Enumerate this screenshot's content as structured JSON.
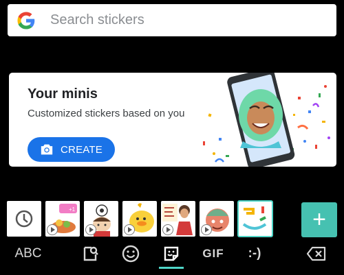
{
  "search": {
    "placeholder": "Search stickers",
    "logo_icon": "google-g-icon"
  },
  "promo": {
    "title": "Your minis",
    "subtitle": "Customized stickers based on you",
    "create_label": "CREATE",
    "create_icon": "camera-icon",
    "accent": "#1a73e8"
  },
  "sticker_tabs": {
    "items": [
      {
        "name": "recent-icon",
        "selected": false
      },
      {
        "name": "sticker-pack-food",
        "animated": true
      },
      {
        "name": "sticker-pack-soccer-kid",
        "animated": true
      },
      {
        "name": "sticker-pack-yellow-bird",
        "animated": true
      },
      {
        "name": "sticker-pack-lettering",
        "animated": true
      },
      {
        "name": "sticker-pack-round-face",
        "animated": true
      },
      {
        "name": "sticker-pack-minis",
        "selected": true
      }
    ],
    "add_label": "+",
    "accent": "#46c1b1"
  },
  "keyboard_tabs": {
    "abc_label": "ABC",
    "gif_label": "GIF",
    "emoticon_label": ":-)",
    "active": "stickers",
    "active_color": "#4fd6c8"
  }
}
